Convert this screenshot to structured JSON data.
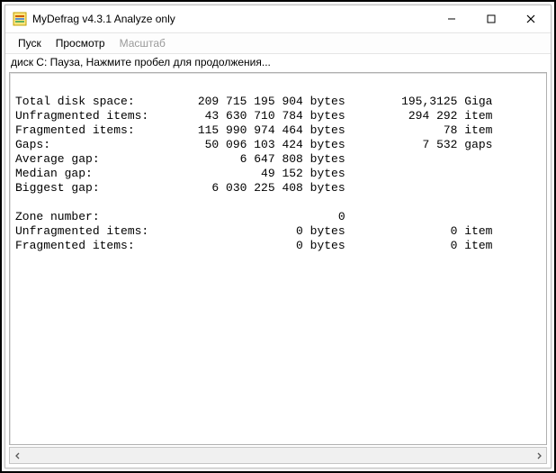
{
  "window": {
    "title": "MyDefrag v4.3.1   Analyze only"
  },
  "menu": {
    "start": "Пуск",
    "view": "Просмотр",
    "zoom": "Масштаб"
  },
  "status": "диск C:   Пауза, Нажмите пробел для продолжения...",
  "report": {
    "rows": [
      {
        "label": "Total disk space:",
        "col1": "209 715 195 904 bytes",
        "col2": "195,3125 Giga"
      },
      {
        "label": "Unfragmented items:",
        "col1": " 43 630 710 784 bytes",
        "col2": "294 292 item"
      },
      {
        "label": "Fragmented items:",
        "col1": "115 990 974 464 bytes",
        "col2": "78 item"
      },
      {
        "label": "Gaps:",
        "col1": " 50 096 103 424 bytes",
        "col2": "7 532 gaps"
      },
      {
        "label": "Average gap:",
        "col1": "      6 647 808 bytes",
        "col2": ""
      },
      {
        "label": "Median gap:",
        "col1": "         49 152 bytes",
        "col2": ""
      },
      {
        "label": "Biggest gap:",
        "col1": "  6 030 225 408 bytes",
        "col2": ""
      },
      {
        "blank": true
      },
      {
        "label": "Zone number:",
        "col1": "                    0",
        "col2": ""
      },
      {
        "label": "Unfragmented items:",
        "col1": "              0 bytes",
        "col2": "0 item"
      },
      {
        "label": "Fragmented items:",
        "col1": "              0 bytes",
        "col2": "0 item"
      }
    ]
  }
}
